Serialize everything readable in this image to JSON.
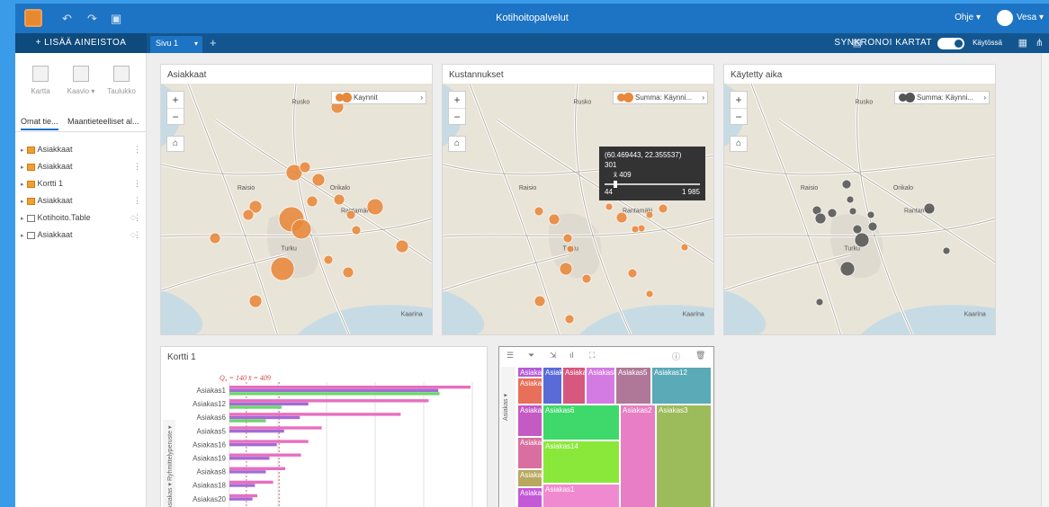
{
  "app": {
    "title": "Kotihoitopalvelut",
    "help_label": "Ohje",
    "user_label": "Vesa"
  },
  "toolbar": {
    "add_data_label": "+  LISÄÄ AINEISTOA",
    "page_tab_label": "Sivu 1",
    "sync_label": "SYNKRONOI KARTAT",
    "sync_state": "Käytössä"
  },
  "sidebar": {
    "viz_buttons": [
      {
        "label": "Kartta"
      },
      {
        "label": "Kaavio ▾"
      },
      {
        "label": "Taulukko"
      }
    ],
    "tabs": [
      {
        "label": "Omat tie..."
      },
      {
        "label": "Maantieteelliset al..."
      }
    ],
    "datasets": [
      {
        "label": "Asiakkaat",
        "type": "geo"
      },
      {
        "label": "Asiakkaat",
        "type": "geo"
      },
      {
        "label": "Kortti 1",
        "type": "geo"
      },
      {
        "label": "Asiakkaat",
        "type": "geo"
      },
      {
        "label": "Kotihoito.Table",
        "type": "table"
      },
      {
        "label": "Asiakkaat",
        "type": "table"
      }
    ]
  },
  "cards": {
    "map1": {
      "title": "Asiakkaat",
      "legend": "Kaynnit",
      "color": "#e8883a"
    },
    "map2": {
      "title": "Kustannukset",
      "legend": "Summa: Käynni...",
      "color": "#e8883a"
    },
    "map3": {
      "title": "Käytetty aika",
      "legend": "Summa: Käynni...",
      "color": "#555555"
    },
    "bar": {
      "title": "Kortti 1",
      "stats": "Q₄ = 140   x̄ = 409",
      "axis_label_1": "Ryhmittelyperuste ▾",
      "axis_label_2": "Asiakas ▾"
    },
    "treemap": {
      "axis_label": "Asiakas ▾"
    }
  },
  "map_labels": {
    "place_1": "Raisio",
    "place_2": "Turku",
    "place_3": "Kaarina",
    "place_4": "Ruskо",
    "place_5": "Rantamäki",
    "place_6": "Orikalo"
  },
  "tooltip": {
    "coords": "(60.469443, 22.355537)",
    "value": "301",
    "mean": "x̄ 409",
    "min": "44",
    "max": "1 985"
  },
  "chart_data": [
    {
      "type": "bar",
      "title": "Kortti 1",
      "categories": [
        "Asiakas1",
        "Asiakas12",
        "Asiakas6",
        "Asiakas5",
        "Asiakas16",
        "Asiakas19",
        "Asiakas8",
        "Asiakas18",
        "Asiakas20"
      ],
      "series": [
        {
          "values": [
            1985,
            1640,
            1410,
            760,
            650,
            590,
            460,
            360,
            230
          ]
        },
        {
          "values": [
            1720,
            650,
            580,
            450,
            390,
            330,
            300,
            210,
            190
          ]
        },
        {
          "values": [
            1730,
            430,
            300,
            0,
            0,
            0,
            0,
            0,
            0
          ]
        }
      ],
      "colors": [
        "#e86fbf",
        "#a46bd6",
        "#6bd66b"
      ]
    },
    {
      "type": "treemap",
      "tiles": [
        {
          "label": "Asiaka",
          "color": "#b55cd8"
        },
        {
          "label": "Asiak",
          "color": "#5a6bd8"
        },
        {
          "label": "Asiaka",
          "color": "#d8577e"
        },
        {
          "label": "Asiakas8",
          "color": "#d47be3"
        },
        {
          "label": "Asiakas5",
          "color": "#b07898"
        },
        {
          "label": "Asiakas12",
          "color": "#5aaab8"
        },
        {
          "label": "Asiaka",
          "color": "#e86f5a"
        },
        {
          "label": "Asiaka",
          "color": "#c45ac4"
        },
        {
          "label": "Asiakas6",
          "color": "#3fd86b"
        },
        {
          "label": "Asiakas2",
          "color": "#e87fc4"
        },
        {
          "label": "Asiakas3",
          "color": "#9cbb5a"
        },
        {
          "label": "Asiaka",
          "color": "#d86fa0"
        },
        {
          "label": "Asiaka",
          "color": "#b8a860"
        },
        {
          "label": "Asiakas14",
          "color": "#8ae83a"
        },
        {
          "label": "Asiaka",
          "color": "#c45ad8"
        },
        {
          "label": "Asiaka",
          "color": "#e87fd8"
        },
        {
          "label": "Asiakas1",
          "color": "#f08ad0"
        }
      ]
    }
  ]
}
